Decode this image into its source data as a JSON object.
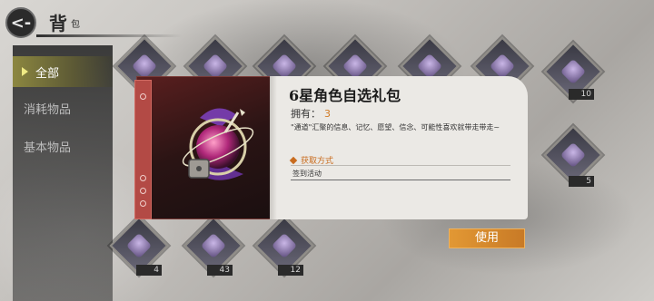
{
  "header": {
    "back_icon": "back-arrow-icon",
    "back_label": "<-",
    "title_main": "背",
    "title_sub": "包"
  },
  "sidebar": {
    "tabs": [
      {
        "label": "全部",
        "active": true
      },
      {
        "label": "消耗物品",
        "active": false
      },
      {
        "label": "基本物品",
        "active": false
      }
    ]
  },
  "grid": {
    "counts": [
      "10",
      "5",
      "4",
      "43",
      "12"
    ]
  },
  "detail": {
    "name": "6星角色自选礼包",
    "owned_label": "拥有：",
    "owned_value": "3",
    "description": "\"通道\"汇聚的信息、记忆、愿望、信念、可能性喜欢就带走带走~",
    "source_header": "获取方式",
    "source_item": "签到活动",
    "art_icon": "gift-orb-icon"
  },
  "actions": {
    "use_label": "使用"
  },
  "colors": {
    "accent_orange": "#d07a25",
    "panel_red": "#b34a45",
    "button_orange": "#e29834"
  }
}
